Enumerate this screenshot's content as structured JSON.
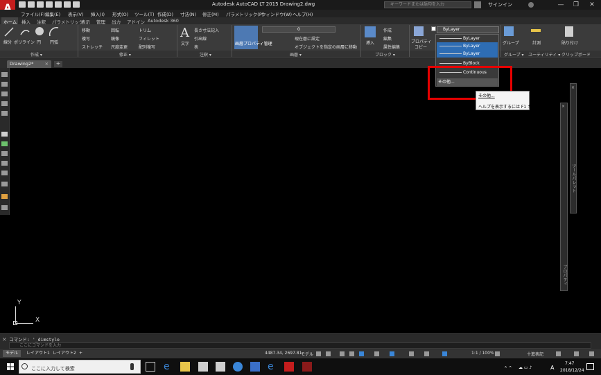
{
  "titlebar": {
    "title": "Autodesk AutoCAD LT 2015   Drawing2.dwg",
    "search_placeholder": "キーワードまたは語句を入力",
    "signin": "サインイン",
    "minimize": "—",
    "restore": "❐",
    "close": "✕"
  },
  "menu": [
    "ファイル(F)",
    "編集(E)",
    "表示(V)",
    "挿入(I)",
    "形式(O)",
    "ツール(T)",
    "作成(D)",
    "寸法(N)",
    "修正(M)",
    "パラメトリック(P)",
    "ウィンドウ(W)",
    "ヘルプ(H)"
  ],
  "ribbon_tabs": [
    "ホーム",
    "挿入",
    "注釈",
    "パラメトリック",
    "表示",
    "管理",
    "出力",
    "アドイン",
    "Autodesk 360"
  ],
  "ribbon": {
    "draw": {
      "label": "作成 ▾",
      "line": "線分",
      "polyline": "ポリライン",
      "circle": "円",
      "arc": "円弧"
    },
    "modify": {
      "label": "修正 ▾",
      "move": "移動",
      "rotate": "回転",
      "trim": "トリム",
      "copy": "複写",
      "mirror": "鏡像",
      "fillet": "フィレット",
      "stretch": "ストレッチ",
      "scale": "尺度変更",
      "array": "配列複写"
    },
    "annotation": {
      "label": "注釈 ▾",
      "text": "文字",
      "linear": "長さ寸法記入",
      "leader": "引出線",
      "table": "表"
    },
    "layers": {
      "label": "画層 ▾",
      "props": "画層プロパティ管理",
      "set_current": "現在層に設定",
      "match": "オブジェクトを指定の画層に移動",
      "layer_value": "0"
    },
    "block": {
      "label": "ブロック ▾",
      "insert": "挿入",
      "create": "作成",
      "edit": "編集",
      "attr_edit": "属性編集"
    },
    "properties": {
      "label": "プロパティ",
      "copy": "コピー",
      "linetype_value": "ByLayer"
    },
    "groups": {
      "label": "グループ ▾",
      "group": "グループ"
    },
    "utilities": {
      "label": "ユーティリティ ▾",
      "measure": "計測"
    },
    "clipboard": {
      "label": "クリップボード",
      "paste": "貼り付け"
    }
  },
  "linetype_list": [
    {
      "label": "ByLayer",
      "selected": false
    },
    {
      "label": "ByLayer",
      "selected": true
    },
    {
      "label": "ByBlock",
      "selected": false
    },
    {
      "label": "Continuous",
      "selected": false
    },
    {
      "label": "その他...",
      "selected": false
    }
  ],
  "tooltip": {
    "title": "その他...",
    "help": "ヘルプを表示するには F1 キー"
  },
  "doc_tab": {
    "name": "Drawing2*",
    "close": "×",
    "new": "+"
  },
  "right_panels": {
    "panel1": "ツールパレット",
    "panel2": "プロパティ"
  },
  "ucs": {
    "y": "Y",
    "x": "X"
  },
  "command": {
    "history": "コマンド: '_dimstyle",
    "placeholder": "ここにコマンドを入力"
  },
  "layout_tabs": [
    "モデル",
    "レイアウト1",
    "レイアウト2",
    "+"
  ],
  "status": {
    "coords": "4487.34, 2697.81",
    "model": "モデル",
    "scale": "1:1 / 100%",
    "decimal": "十進表記"
  },
  "taskbar": {
    "search": "ここに入力して検索",
    "time": "7:47",
    "date": "2018/12/24",
    "ime": "A"
  },
  "colors": {
    "accent_red": "#e60000",
    "autocad_red": "#c41d1d",
    "ribbon_bg": "#3b3b3b",
    "selection_blue": "#2e6db4"
  }
}
